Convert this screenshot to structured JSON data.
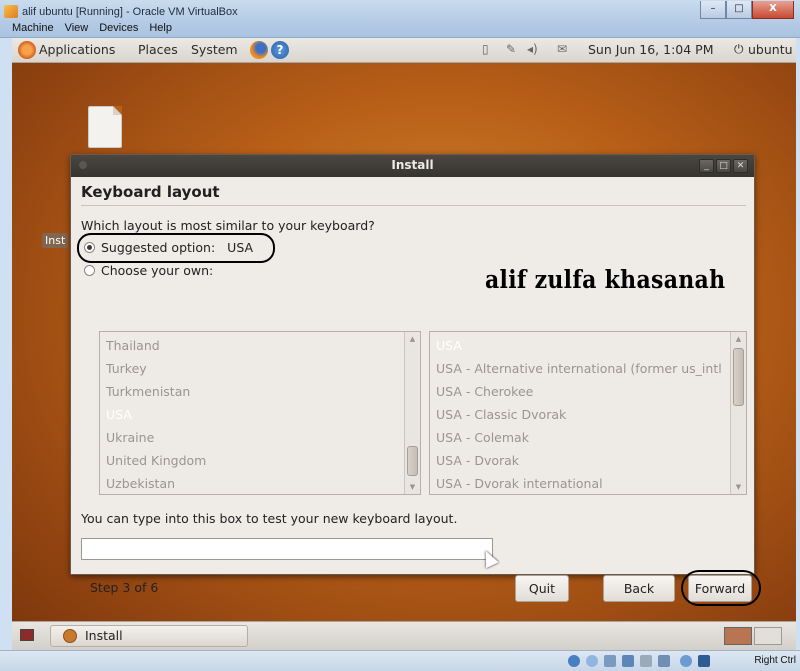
{
  "host_window": {
    "title": "alif ubuntu [Running] - Oracle VM VirtualBox",
    "controls": [
      "–",
      "□",
      "X"
    ],
    "menu": [
      "Machine",
      "View",
      "Devices",
      "Help"
    ]
  },
  "guest_panel": {
    "menus": [
      "Applications",
      "Places",
      "System"
    ],
    "clock": "Sun Jun 16,  1:04 PM",
    "user": "ubuntu",
    "icons": [
      "firefox-icon",
      "help-icon",
      "network-icon",
      "volume-icon",
      "mail-icon"
    ]
  },
  "desktop": {
    "icon_label": "Inst"
  },
  "install_dialog": {
    "window_title": "Install",
    "section_title": "Keyboard layout",
    "question": "Which layout is most similar to your keyboard?",
    "suggested_label": "Suggested option:",
    "suggested_value": "USA",
    "choose_label": "Choose your own:",
    "layouts": [
      "Thailand",
      "Turkey",
      "Turkmenistan",
      "USA",
      "Ukraine",
      "United Kingdom",
      "Uzbekistan"
    ],
    "selected_layout": "USA",
    "variants": [
      "USA",
      "USA - Alternative international (former us_intl",
      "USA - Cherokee",
      "USA - Classic Dvorak",
      "USA - Colemak",
      "USA - Dvorak",
      "USA - Dvorak international"
    ],
    "selected_variant": "USA",
    "test_label": "You can type into this box to test your new keyboard layout.",
    "test_value": "",
    "step": "Step 3 of 6",
    "buttons": {
      "quit": "Quit",
      "back": "Back",
      "forward": "Forward"
    }
  },
  "watermark": "alif zulfa khasanah",
  "taskbar": {
    "task": "Install"
  },
  "vbox_status": {
    "host_key": "Right Ctrl"
  },
  "colors": {
    "wallpaper": "#b85f18",
    "dialog_bg": "#efebe7",
    "dialog_titlebar": "#3e3c38",
    "annotation_oval": "#000000"
  }
}
